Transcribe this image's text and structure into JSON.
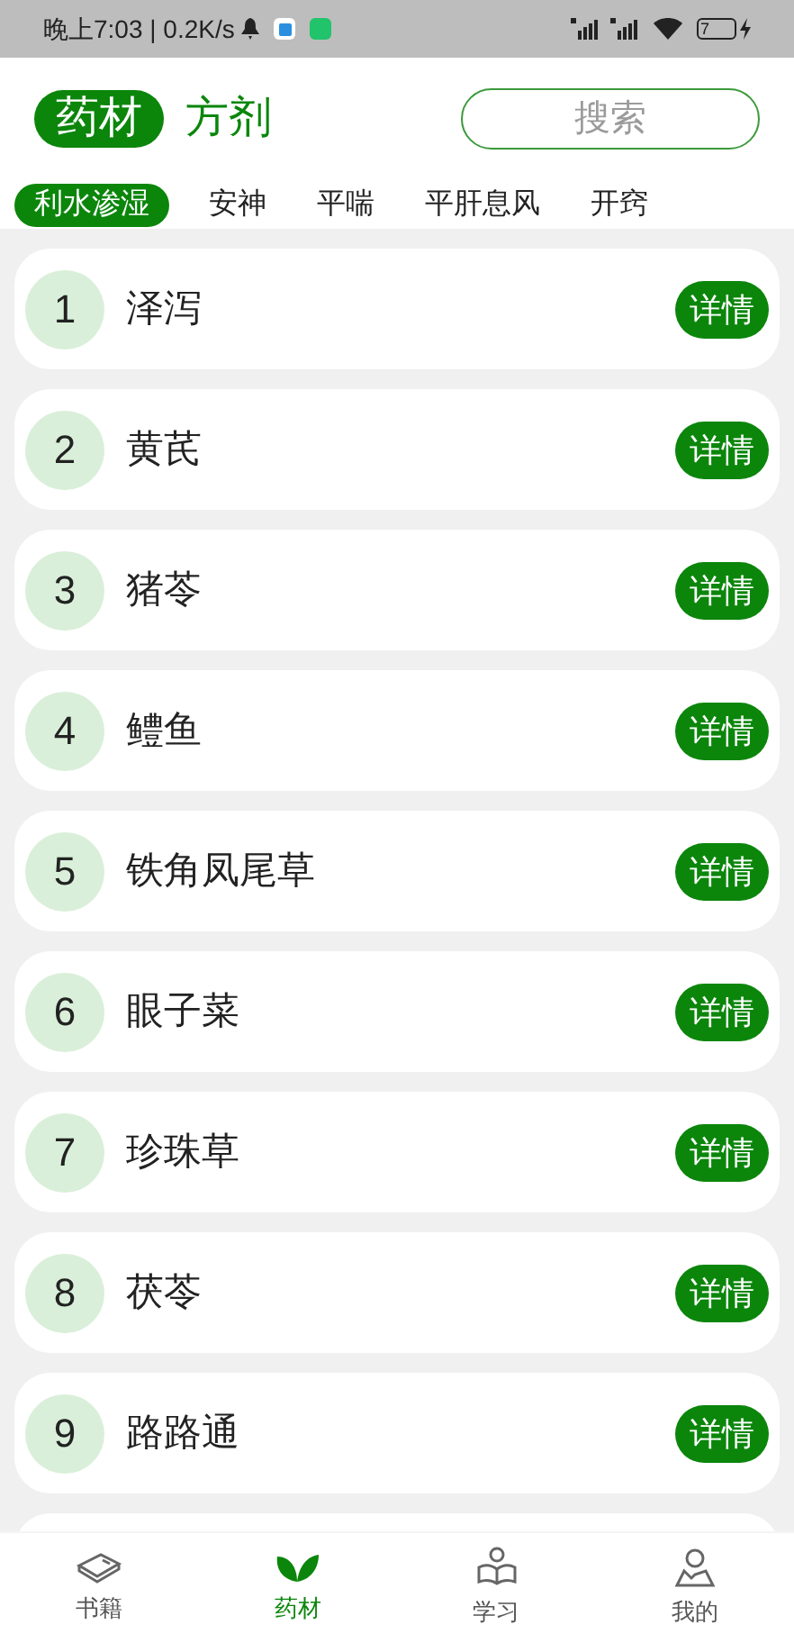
{
  "status_bar": {
    "time": "晚上7:03 | 0.2K/s",
    "battery": "7"
  },
  "header_tabs": [
    {
      "label": "药材",
      "selected": true
    },
    {
      "label": "方剂",
      "selected": false
    }
  ],
  "search": {
    "placeholder": "搜索"
  },
  "categories": [
    {
      "label": "利水渗湿",
      "selected": true
    },
    {
      "label": "安神",
      "selected": false
    },
    {
      "label": "平喘",
      "selected": false
    },
    {
      "label": "平肝息风",
      "selected": false
    },
    {
      "label": "开窍",
      "selected": false
    }
  ],
  "items": [
    {
      "number": "1",
      "name": "泽泻",
      "button": "详情"
    },
    {
      "number": "2",
      "name": "黄芪",
      "button": "详情"
    },
    {
      "number": "3",
      "name": "猪苓",
      "button": "详情"
    },
    {
      "number": "4",
      "name": "鳢鱼",
      "button": "详情"
    },
    {
      "number": "5",
      "name": "铁角凤尾草",
      "button": "详情"
    },
    {
      "number": "6",
      "name": "眼子菜",
      "button": "详情"
    },
    {
      "number": "7",
      "name": "珍珠草",
      "button": "详情"
    },
    {
      "number": "8",
      "name": "茯苓",
      "button": "详情"
    },
    {
      "number": "9",
      "name": "路路通",
      "button": "详情"
    }
  ],
  "nav": [
    {
      "label": "书籍",
      "kind": "book",
      "selected": false
    },
    {
      "label": "药材",
      "kind": "leaf",
      "selected": true
    },
    {
      "label": "学习",
      "kind": "reader",
      "selected": false
    },
    {
      "label": "我的",
      "kind": "person",
      "selected": false
    }
  ]
}
